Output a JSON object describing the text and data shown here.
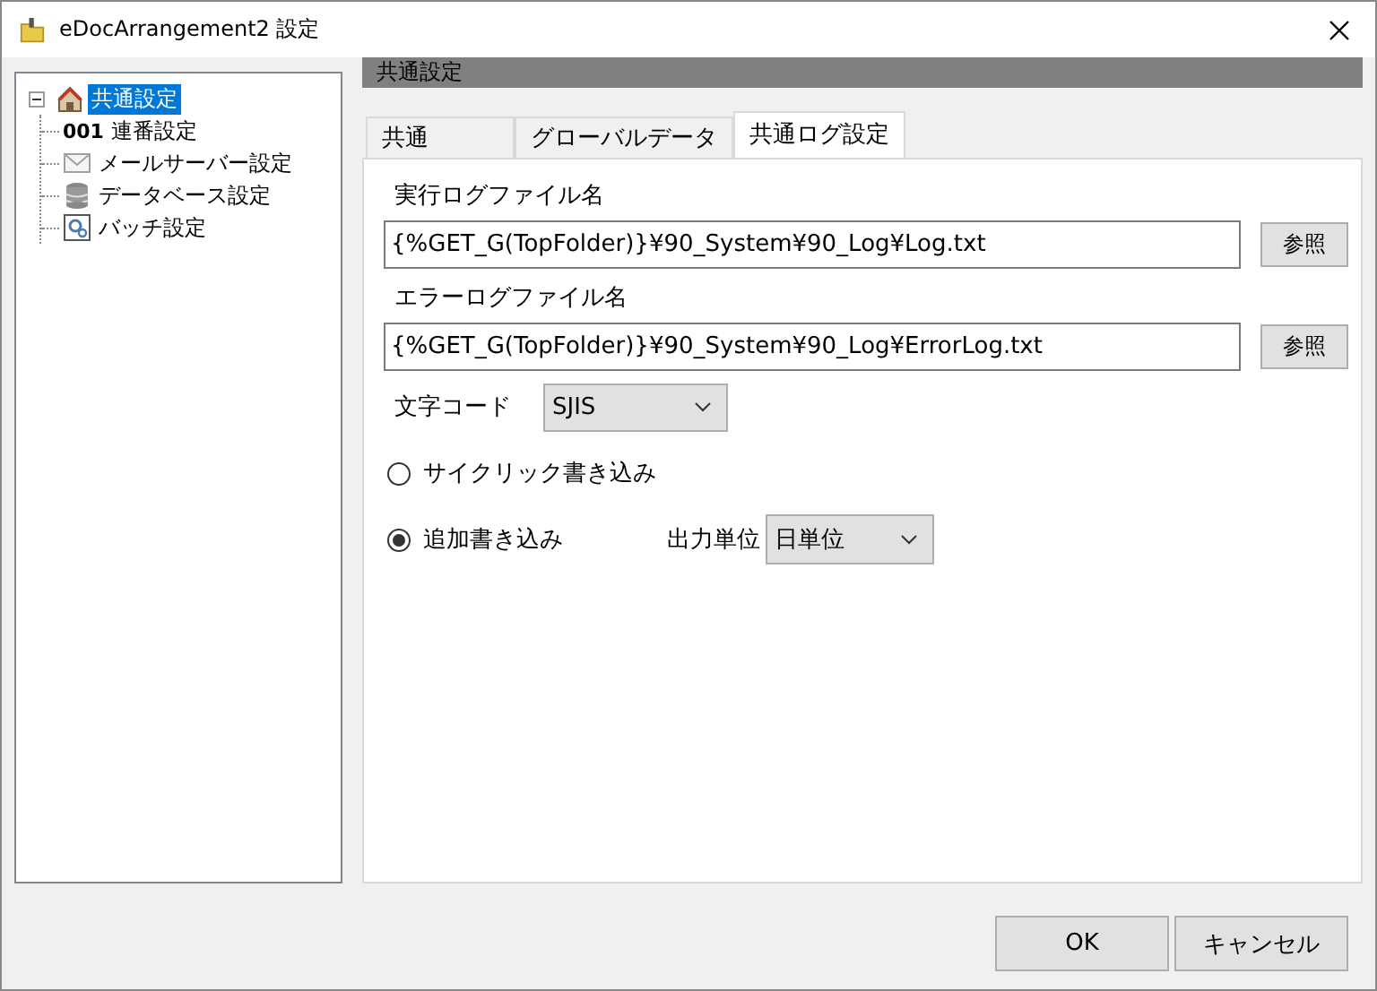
{
  "window": {
    "title": "eDocArrangement2 設定"
  },
  "tree": [
    {
      "label": "共通設定",
      "kind": "house",
      "selected": true,
      "expanded": true,
      "children": [
        {
          "label": "連番設定",
          "kind": "number",
          "prefix": "001",
          "selected": false
        },
        {
          "label": "メールサーバー設定",
          "kind": "mail",
          "selected": false
        },
        {
          "label": "データベース設定",
          "kind": "database",
          "selected": false
        },
        {
          "label": "バッチ設定",
          "kind": "batch",
          "selected": false
        }
      ]
    }
  ],
  "section_title": "共通設定",
  "tabs": [
    {
      "label": "共通",
      "selected": false
    },
    {
      "label": "グローバルデータ",
      "selected": false
    },
    {
      "label": "共通ログ設定",
      "selected": true
    }
  ],
  "files": [
    {
      "label": "実行ログファイル名",
      "value": "{%GET_G(TopFolder)}¥90_System¥90_Log¥Log.txt",
      "button": "参照"
    },
    {
      "label": "エラーログファイル名",
      "value": "{%GET_G(TopFolder)}¥90_System¥90_Log¥ErrorLog.txt",
      "button": "参照"
    }
  ],
  "encoding": {
    "label": "文字コード",
    "value": "SJIS"
  },
  "write_modes": [
    {
      "label": "サイクリック書き込み",
      "selected": false
    },
    {
      "label": "追加書き込み",
      "selected": true,
      "unit": {
        "label": "出力単位",
        "value": "日単位"
      }
    }
  ],
  "buttons": [
    "OK",
    "キャンセル"
  ]
}
